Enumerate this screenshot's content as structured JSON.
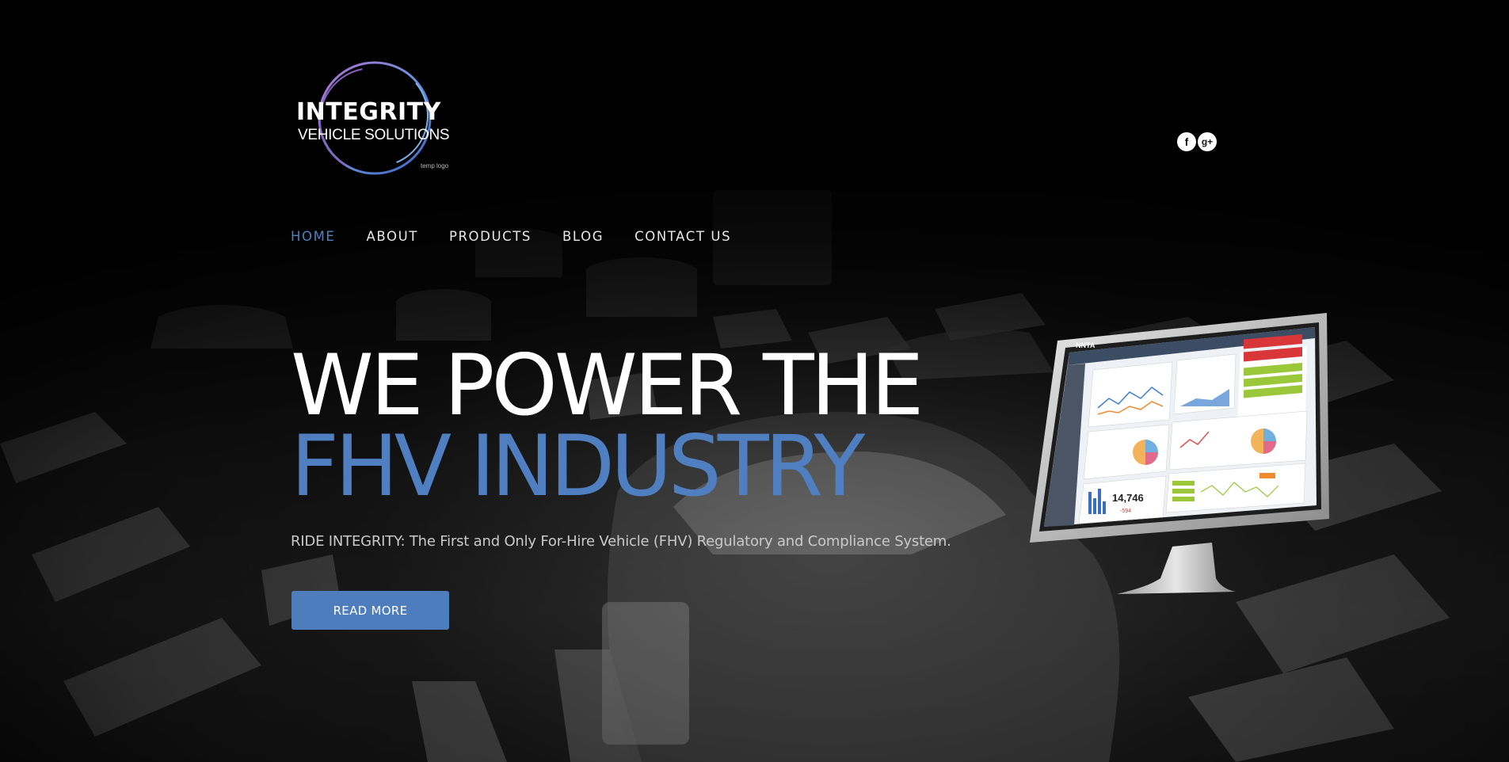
{
  "brand": {
    "name_line1": "INTEGRITY",
    "name_line2": "VEHICLE SOLUTIONS",
    "note": "temp logo"
  },
  "social": [
    {
      "icon": "facebook-icon",
      "glyph": "f"
    },
    {
      "icon": "google-plus-icon",
      "glyph": "g+"
    }
  ],
  "nav": {
    "items": [
      {
        "label": "HOME",
        "active": true
      },
      {
        "label": "ABOUT"
      },
      {
        "label": "PRODUCTS"
      },
      {
        "label": "BLOG"
      },
      {
        "label": "CONTACT US"
      }
    ]
  },
  "hero": {
    "headline_line1": "WE POWER THE",
    "headline_line2": "FHV INDUSTRY",
    "subtitle": "RIDE INTEGRITY: The First and Only For-Hire Vehicle (FHV) Regulatory and Compliance System.",
    "cta_label": "READ MORE"
  },
  "monitor_screen": {
    "app_name": "NNTA",
    "stat_value": "14,746",
    "stat_delta": "-594"
  },
  "colors": {
    "accent": "#4f7fc0",
    "background": "#0a0a0a",
    "text": "#ffffff",
    "muted_text": "#c9c9c9"
  }
}
